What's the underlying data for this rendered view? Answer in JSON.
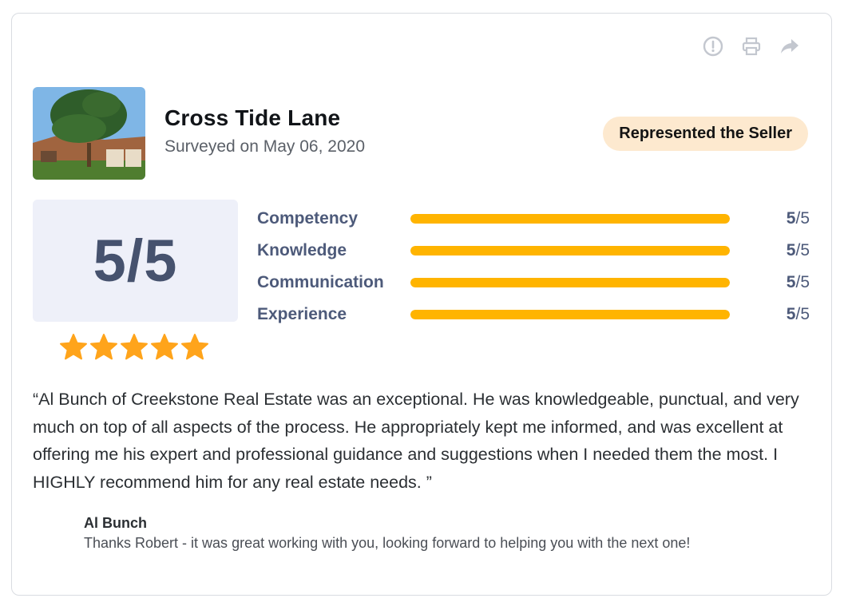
{
  "toolbar": {
    "report_icon": "exclamation-circle-icon",
    "print_icon": "printer-icon",
    "share_icon": "share-arrow-icon"
  },
  "listing": {
    "title": "Cross Tide Lane",
    "surveyed": "Surveyed on May 06, 2020",
    "badge": "Represented the Seller"
  },
  "rating": {
    "overall": "5/5",
    "stars": 5,
    "metrics": [
      {
        "label": "Competency",
        "score": "5",
        "max": "/5",
        "fraction": 1.0
      },
      {
        "label": "Knowledge",
        "score": "5",
        "max": "/5",
        "fraction": 1.0
      },
      {
        "label": "Communication",
        "score": "5",
        "max": "/5",
        "fraction": 1.0
      },
      {
        "label": "Experience",
        "score": "5",
        "max": "/5",
        "fraction": 1.0
      }
    ]
  },
  "review": {
    "text": "“Al Bunch of Creekstone Real Estate was an exceptional. He was knowledgeable, punctual, and very much on top of all aspects of the process. He appropriately kept me informed, and was excellent at offering me his expert and professional guidance and suggestions when I needed them the most. I HIGHLY recommend him for any real estate needs. ”"
  },
  "reply": {
    "author": "Al Bunch",
    "text": "Thanks Robert - it was great working with you, looking forward to helping you with the next one!"
  },
  "colors": {
    "bar": "#ffb400",
    "star": "#ffa41b",
    "score_text": "#46526e",
    "badge_bg": "#fde9cf"
  }
}
